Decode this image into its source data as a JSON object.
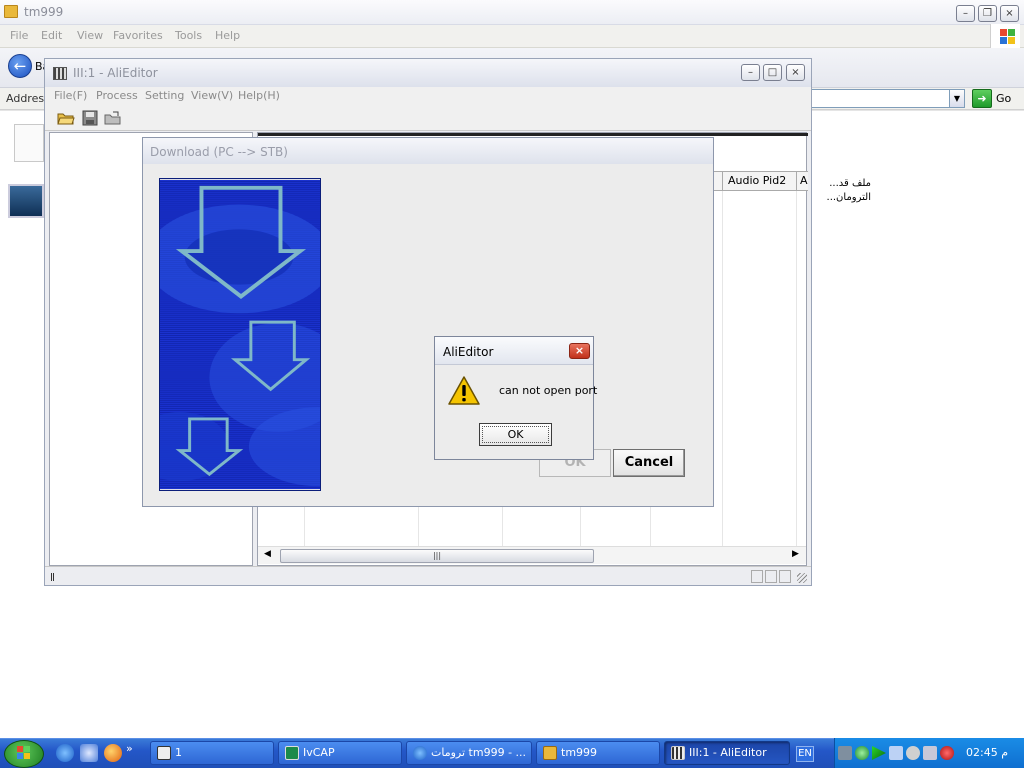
{
  "explorer": {
    "title": "tm999",
    "menu": [
      "File",
      "Edit",
      "View",
      "Favorites",
      "Tools",
      "Help"
    ],
    "back_label": "Ba",
    "address_label": "Address",
    "go_label": "Go",
    "side_text": "ملف قد... الترومان..."
  },
  "ali": {
    "title": "III:1 - AliEditor",
    "menu": [
      "File(F)",
      "Process",
      "Setting",
      "View(V)",
      "Help(H)"
    ],
    "columns": [
      "Audio Pid2",
      "A"
    ]
  },
  "download": {
    "title": "Download (PC --> STB)",
    "ok_label": "OK",
    "cancel_label": "Cancel"
  },
  "msgbox": {
    "title": "AliEditor",
    "message": "can not open port",
    "ok_label": "OK",
    "close_glyph": "×"
  },
  "taskbar": {
    "items": [
      {
        "label": "1"
      },
      {
        "label": "IvCAP"
      },
      {
        "label": "ترومات tm999 - ..."
      },
      {
        "label": "tm999"
      },
      {
        "label": "III:1 - AliEditor"
      }
    ],
    "lang": "EN",
    "clock": "02:45 م"
  },
  "colors": {
    "taskbar_blue": "#2457c8",
    "tray_blue": "#0f6fd0",
    "banner_blue": "#1530c8",
    "warning_yellow": "#f5c400"
  }
}
